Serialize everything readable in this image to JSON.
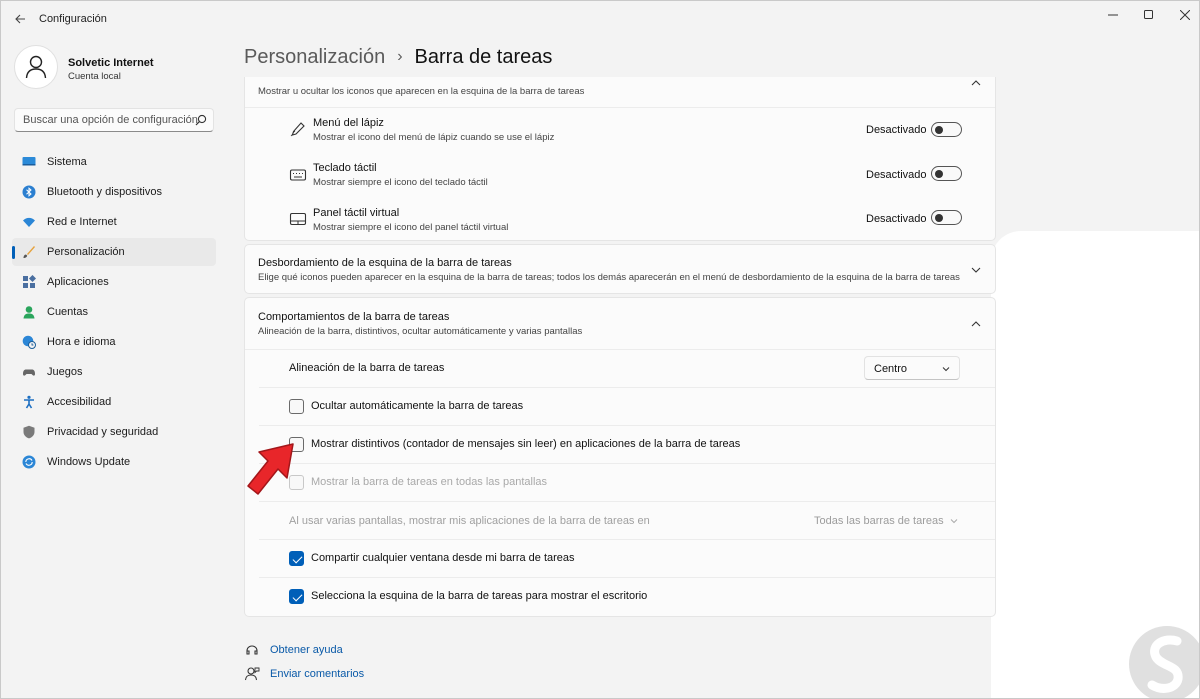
{
  "window": {
    "title": "Configuración",
    "controls": [
      "minimize",
      "maximize",
      "close"
    ]
  },
  "profile": {
    "name": "Solvetic Internet",
    "account": "Cuenta local"
  },
  "search": {
    "placeholder": "Buscar una opción de configuración"
  },
  "sidebar": {
    "items": [
      {
        "label": "Sistema",
        "icon": "monitor-icon",
        "active": false
      },
      {
        "label": "Bluetooth y dispositivos",
        "icon": "bluetooth-icon",
        "active": false
      },
      {
        "label": "Red e Internet",
        "icon": "wifi-icon",
        "active": false
      },
      {
        "label": "Personalización",
        "icon": "brush-icon",
        "active": true
      },
      {
        "label": "Aplicaciones",
        "icon": "apps-icon",
        "active": false
      },
      {
        "label": "Cuentas",
        "icon": "person-icon",
        "active": false
      },
      {
        "label": "Hora e idioma",
        "icon": "globe-clock-icon",
        "active": false
      },
      {
        "label": "Juegos",
        "icon": "gamepad-icon",
        "active": false
      },
      {
        "label": "Accesibilidad",
        "icon": "accessibility-icon",
        "active": false
      },
      {
        "label": "Privacidad y seguridad",
        "icon": "shield-icon",
        "active": false
      },
      {
        "label": "Windows Update",
        "icon": "update-icon",
        "active": false
      }
    ]
  },
  "breadcrumb": {
    "parent": "Personalización",
    "separator": "›",
    "current": "Barra de tareas"
  },
  "corner_icons": {
    "subtitle": "Mostrar u ocultar los iconos que aparecen en la esquina de la barra de tareas",
    "items": [
      {
        "title": "Menú del lápiz",
        "sub": "Mostrar el icono del menú de lápiz cuando se use el lápiz",
        "state": "Desactivado",
        "icon": "pen-icon"
      },
      {
        "title": "Teclado táctil",
        "sub": "Mostrar siempre el icono del teclado táctil",
        "state": "Desactivado",
        "icon": "keyboard-icon"
      },
      {
        "title": "Panel táctil virtual",
        "sub": "Mostrar siempre el icono del panel táctil virtual",
        "state": "Desactivado",
        "icon": "touchpad-icon"
      }
    ]
  },
  "overflow": {
    "title": "Desbordamiento de la esquina de la barra de tareas",
    "subtitle": "Elige qué iconos pueden aparecer en la esquina de la barra de tareas; todos los demás aparecerán en el menú de desbordamiento de la esquina de la barra de tareas"
  },
  "behaviors": {
    "title": "Comportamientos de la barra de tareas",
    "subtitle": "Alineación de la barra, distintivos, ocultar automáticamente y varias pantallas",
    "alignment_label": "Alineación de la barra de tareas",
    "alignment_value": "Centro",
    "options": [
      {
        "label": "Ocultar automáticamente la barra de tareas",
        "checked": false,
        "disabled": false
      },
      {
        "label": "Mostrar distintivos (contador de mensajes sin leer) en aplicaciones de la barra de tareas",
        "checked": false,
        "disabled": false
      },
      {
        "label": "Mostrar la barra de tareas en todas las pantallas",
        "checked": false,
        "disabled": true
      }
    ],
    "multi_label": "Al usar varias pantallas, mostrar mis aplicaciones de la barra de tareas en",
    "multi_value": "Todas las barras de tareas",
    "options2": [
      {
        "label": "Compartir cualquier ventana desde mi barra de tareas",
        "checked": true,
        "disabled": false
      },
      {
        "label": "Selecciona la esquina de la barra de tareas para mostrar el escritorio",
        "checked": true,
        "disabled": false
      }
    ]
  },
  "footer": {
    "help": "Obtener ayuda",
    "feedback": "Enviar comentarios"
  },
  "colors": {
    "accent": "#005fb8",
    "arrow": "#e8262a",
    "link": "#0a5aa8"
  }
}
